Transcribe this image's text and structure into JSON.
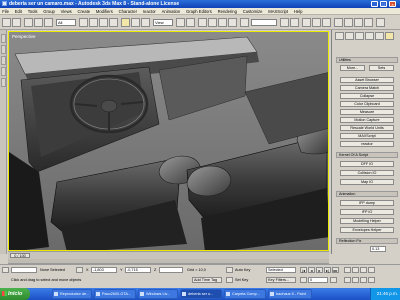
{
  "window": {
    "title": "deberia ser un camaro.max - Autodesk 3ds Max 8 - Stand-alone License",
    "minimize": "_",
    "maximize": "□",
    "close": "×"
  },
  "menu": [
    "File",
    "Edit",
    "Tools",
    "Group",
    "Views",
    "Create",
    "Modifiers",
    "Character",
    "reactor",
    "Animation",
    "Graph Editors",
    "Rendering",
    "Customize",
    "MAXScript",
    "Help"
  ],
  "toolbar": {
    "selection_filter": "All",
    "view_dropdown": "View",
    "named_selection": ""
  },
  "viewport": {
    "label": "Perspective"
  },
  "panel": {
    "utilities_group": "Utilities",
    "more_button": "More...",
    "sets_button": "Sets",
    "buttons": [
      "Asset Browser",
      "Camera Match",
      "Collapse",
      "Color Clipboard",
      "Measure",
      "Motion Capture",
      "Rescale World Units",
      "MAXScript",
      "reactor"
    ],
    "kernel_group": "Kernel Of A Script",
    "kernel_buttons": [
      "DFF IO",
      "Collision IO",
      "Map IO"
    ],
    "animation_group": "Animation",
    "animation_buttons": [
      "IFP dump",
      "IFP IO",
      "Modelling Helper",
      "Envelopes Helper"
    ],
    "reflection_label": "Reflection Fix",
    "reflection_value": "0.13"
  },
  "timeline": {
    "frame_display": "0 / 100"
  },
  "status": {
    "selection": "None Selected",
    "prompt": "Click and drag to select and move objects",
    "x_label": "X",
    "x_value": "-1,803",
    "y_label": "Y",
    "y_value": "-0,715",
    "z_label": "Z",
    "z_value": "",
    "grid": "Grid = 10,0",
    "add_time_tag": "Add Time Tag",
    "auto_key": "Auto Key",
    "set_key": "Set Key",
    "key_mode": "Selected",
    "key_filters": "Key Filters...",
    "current_frame": "0"
  },
  "taskbar": {
    "start": "Inicio",
    "tasks": [
      "Reproductor de...",
      "Paco2600-GTA...",
      "Windows Liv...",
      "deberia ser u...",
      "Carpeta Comp...",
      "bauhaus 5 - Paint"
    ],
    "active_task_index": 3,
    "clock": "21:46 p.m."
  }
}
